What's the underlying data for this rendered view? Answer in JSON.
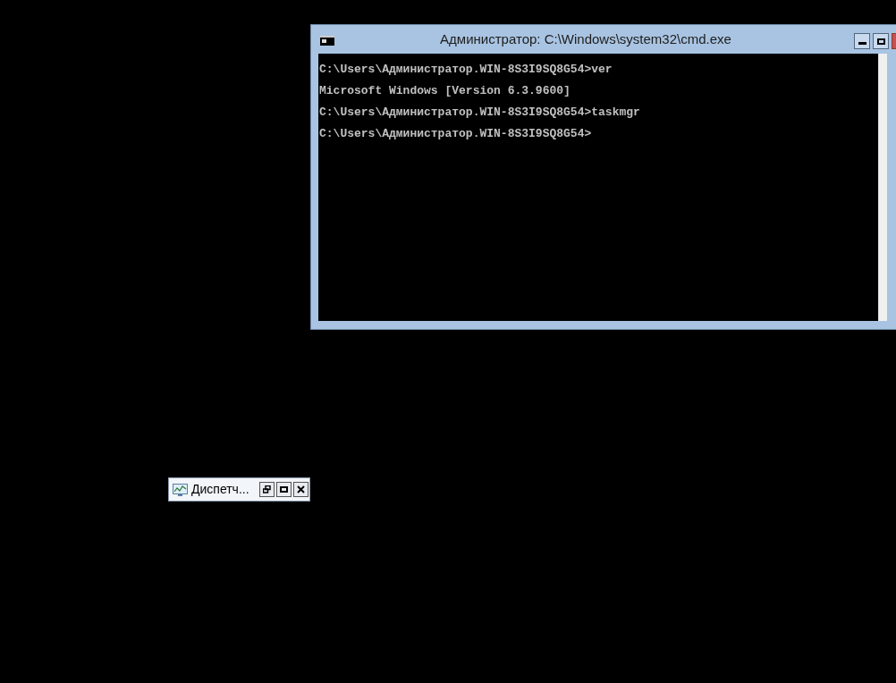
{
  "console_window": {
    "title": "Администратор: C:\\Windows\\system32\\cmd.exe",
    "lines": [
      "C:\\Users\\Администратор.WIN-8S3I9SQ8G54>ver",
      "Microsoft Windows [Version 6.3.9600]",
      "C:\\Users\\Администратор.WIN-8S3I9SQ8G54>taskmgr",
      "C:\\Users\\Администратор.WIN-8S3I9SQ8G54>"
    ]
  },
  "minimized_window": {
    "title": "Диспетч..."
  }
}
